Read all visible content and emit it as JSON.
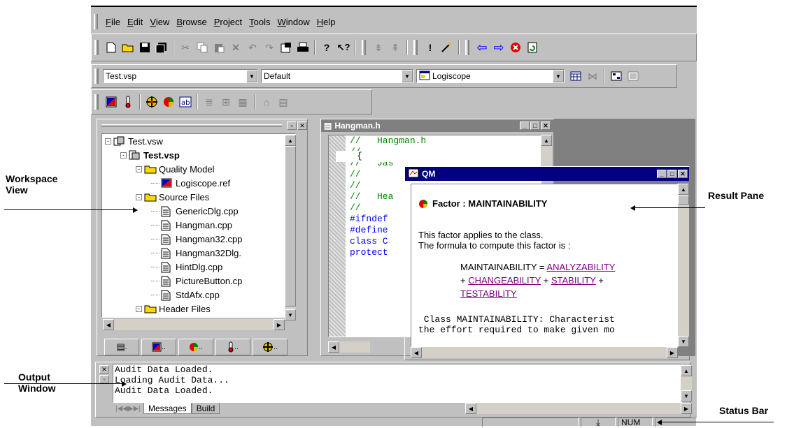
{
  "menu": [
    "File",
    "Edit",
    "View",
    "Browse",
    "Project",
    "Tools",
    "Window",
    "Help"
  ],
  "combos": {
    "workspace": "Test.vsp",
    "config": "Default",
    "tool": "Logiscope"
  },
  "workspace_tree": [
    {
      "label": "Test.vsw",
      "level": 0,
      "toggle": "-",
      "icon": "workspace-icon",
      "bold": false
    },
    {
      "label": "Test.vsp",
      "level": 1,
      "toggle": "-",
      "icon": "project-icon",
      "bold": true
    },
    {
      "label": "Quality Model",
      "level": 2,
      "toggle": "-",
      "icon": "folder-icon",
      "bold": false
    },
    {
      "label": "Logiscope.ref",
      "level": 3,
      "toggle": "",
      "icon": "logiscope-ref-icon",
      "bold": false
    },
    {
      "label": "Source Files",
      "level": 2,
      "toggle": "-",
      "icon": "folder-icon",
      "bold": false
    },
    {
      "label": "GenericDlg.cpp",
      "level": 3,
      "toggle": "",
      "icon": "file-icon",
      "bold": false
    },
    {
      "label": "Hangman.cpp",
      "level": 3,
      "toggle": "",
      "icon": "file-icon",
      "bold": false
    },
    {
      "label": "Hangman32.cpp",
      "level": 3,
      "toggle": "",
      "icon": "file-icon",
      "bold": false
    },
    {
      "label": "Hangman32Dlg.",
      "level": 3,
      "toggle": "",
      "icon": "file-icon",
      "bold": false
    },
    {
      "label": "HintDlg.cpp",
      "level": 3,
      "toggle": "",
      "icon": "file-icon",
      "bold": false
    },
    {
      "label": "PictureButton.cp",
      "level": 3,
      "toggle": "",
      "icon": "file-icon",
      "bold": false
    },
    {
      "label": "StdAfx.cpp",
      "level": 3,
      "toggle": "",
      "icon": "file-icon",
      "bold": false
    },
    {
      "label": "Header Files",
      "level": 2,
      "toggle": "-",
      "icon": "folder-icon",
      "bold": false
    }
  ],
  "editor": {
    "title": "Hangman.h",
    "lines": [
      {
        "text": "//   Hangman.h",
        "kind": "comment"
      },
      {
        "text": "//",
        "kind": "comment"
      },
      {
        "text": "//   Jas",
        "kind": "comment"
      },
      {
        "text": "//",
        "kind": "comment"
      },
      {
        "text": "//",
        "kind": "comment"
      },
      {
        "text": "//   Hea",
        "kind": "comment"
      },
      {
        "text": "//",
        "kind": "comment"
      },
      {
        "text": "",
        "kind": "code"
      },
      {
        "text": "#ifndef",
        "kind": "keyword"
      },
      {
        "text": "#define",
        "kind": "keyword"
      },
      {
        "text": "",
        "kind": "code"
      },
      {
        "text": "class C",
        "kind": "keyword"
      },
      {
        "text": "{",
        "kind": "code"
      },
      {
        "text": "protect",
        "kind": "keyword"
      }
    ]
  },
  "qm": {
    "title": "QM",
    "factor_heading": "Factor : MAINTAINABILITY",
    "para1": "This factor applies to the class.",
    "para2": "The formula to compute this factor is :",
    "formula_prefix": "MAINTAINABILITY = ",
    "link1": "ANALYZABILITY",
    "plus1": "+ ",
    "link2": "CHANGEABILITY",
    "plus2": " + ",
    "link3": "STABILITY",
    "plus3": " +",
    "link4": "TESTABILITY",
    "mono1": " Class MAINTAINABILITY: Characterist",
    "mono2": "the effort required to make given mo"
  },
  "output": {
    "lines": [
      "Audit Data Loaded.",
      "Loading Audit Data...",
      "Audit Data Loaded."
    ],
    "tabs": [
      "Messages",
      "Build"
    ]
  },
  "status": {
    "num": "NUM"
  },
  "callouts": {
    "workspace_view": "Workspace\nView",
    "result_pane": "Result Pane",
    "output_window": "Output\nWindow",
    "status_bar": "Status Bar"
  }
}
